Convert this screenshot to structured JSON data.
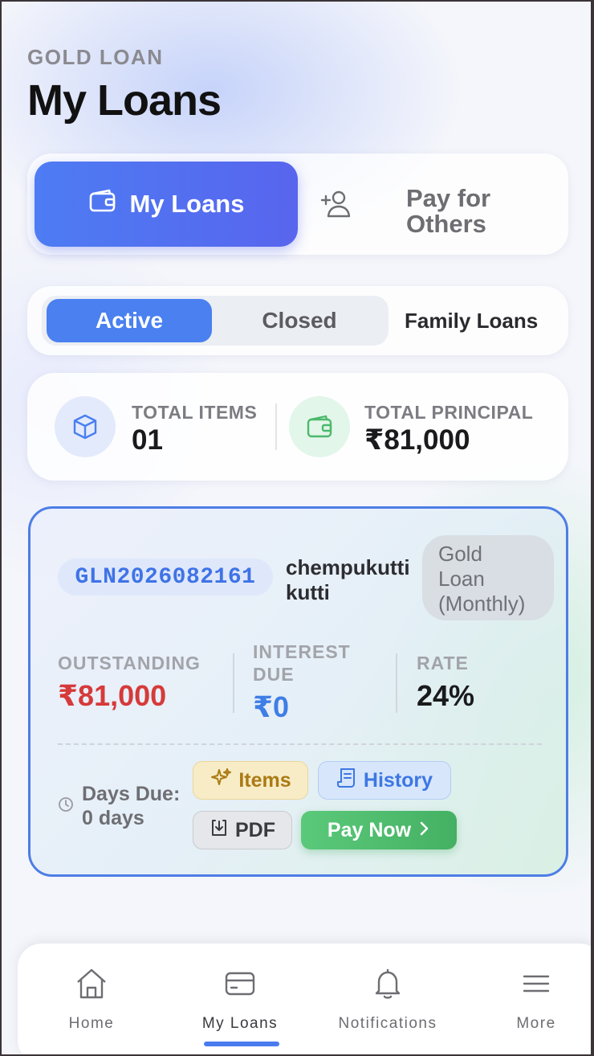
{
  "header": {
    "eyebrow": "GOLD LOAN",
    "title": "My Loans"
  },
  "segments": {
    "my_loans_label": "My Loans",
    "pay_for_others_line1": "Pay for",
    "pay_for_others_line2": "Others"
  },
  "status_tabs": {
    "active": "Active",
    "closed": "Closed",
    "family": "Family Loans",
    "selected": "Active"
  },
  "summary": {
    "total_items_label": "TOTAL ITEMS",
    "total_items_value": "01",
    "total_principal_label": "TOTAL PRINCIPAL",
    "total_principal_value": "₹81,000"
  },
  "loan": {
    "id": "GLN2026082161",
    "borrower_line1": "chempukutti",
    "borrower_line2": "kutti",
    "scheme_line1": "Gold",
    "scheme_line2": "Loan",
    "scheme_line3": "(Monthly)",
    "outstanding_label": "OUTSTANDING",
    "outstanding_value": "₹81,000",
    "interest_label_line1": "INTEREST",
    "interest_label_line2": "DUE",
    "interest_value": "₹0",
    "rate_label": "RATE",
    "rate_value": "24%",
    "days_due_line1": "Days Due:",
    "days_due_line2": "0 days",
    "actions": {
      "items": "Items",
      "history": "History",
      "pdf": "PDF",
      "pay_now": "Pay Now"
    }
  },
  "bottom_nav": {
    "home": "Home",
    "my_loans": "My Loans",
    "notifications": "Notifications",
    "more": "More",
    "selected": "My Loans"
  },
  "colors": {
    "accent": "#4a80f0",
    "outstanding": "#d63a3a",
    "interest": "#3f7ee6",
    "pay": "#4cb86c"
  }
}
